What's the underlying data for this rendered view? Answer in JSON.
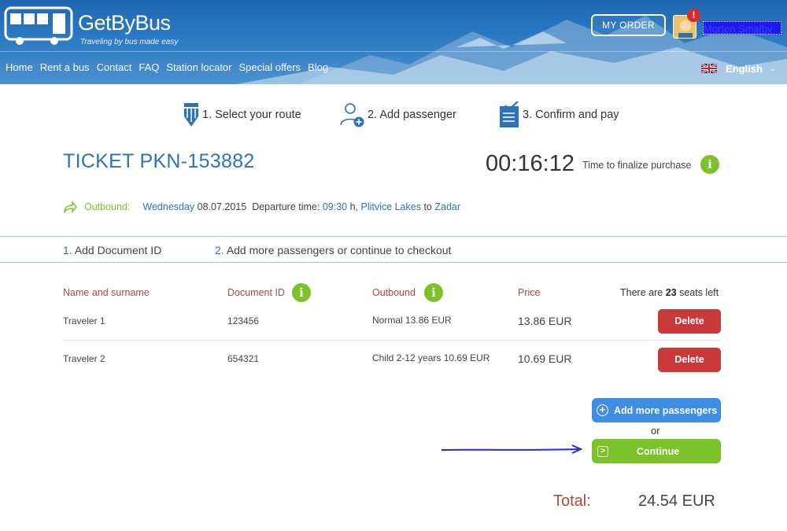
{
  "header": {
    "logo_name": "GetByBus",
    "logo_tagline": "Traveling by bus made easy",
    "my_order_label": "MY ORDER",
    "alert_badge": "!",
    "user_name": "Morten Smalby",
    "nav": [
      "Home",
      "Rent a bus",
      "Contact",
      "FAQ",
      "Station locator",
      "Special offers",
      "Blog"
    ],
    "language": "English"
  },
  "steps": [
    {
      "label": "1. Select your route",
      "icon": "pencil-icon"
    },
    {
      "label": "2. Add passenger",
      "icon": "add-user-icon"
    },
    {
      "label": "3. Confirm and pay",
      "icon": "checklist-icon"
    }
  ],
  "ticket": {
    "title": "TICKET PKN-153882",
    "timer": "00:16:12",
    "timer_label": "Time to finalize purchase"
  },
  "outbound": {
    "label": "Outbound:",
    "day": "Wednesday",
    "date": "08.07.2015",
    "departure_label": "Departure time:",
    "time": "09:30",
    "time_suffix": "h,",
    "from": "Plitvice Lakes",
    "to_word": "to",
    "to": "Zadar"
  },
  "substeps": [
    {
      "num": "1.",
      "label": "Add Document ID"
    },
    {
      "num": "2.",
      "label": "Add more passengers or continue to checkout"
    }
  ],
  "table": {
    "headers": {
      "name": "Name and surname",
      "document": "Document ID",
      "outbound": "Outbound",
      "price": "Price"
    },
    "seats_prefix": "There are",
    "seats_count": "23",
    "seats_suffix": "seats left",
    "rows": [
      {
        "name": "Traveler 1",
        "document": "123456",
        "outbound": "Normal 13.86 EUR",
        "price": "13.86 EUR",
        "action": "Delete"
      },
      {
        "name": "Traveler 2",
        "document": "654321",
        "outbound": "Child 2-12 years 10.69 EUR",
        "price": "10.69 EUR",
        "action": "Delete"
      }
    ]
  },
  "actions": {
    "add_more": "Add more passengers",
    "or": "or",
    "continue": "Continue"
  },
  "total": {
    "label": "Total:",
    "value": "24.54 EUR"
  },
  "colors": {
    "brand_blue": "#2d72ba",
    "green": "#7cc22a",
    "red": "#c9393a",
    "header_label_red": "#b0483a",
    "button_blue": "#3e8ee5"
  }
}
